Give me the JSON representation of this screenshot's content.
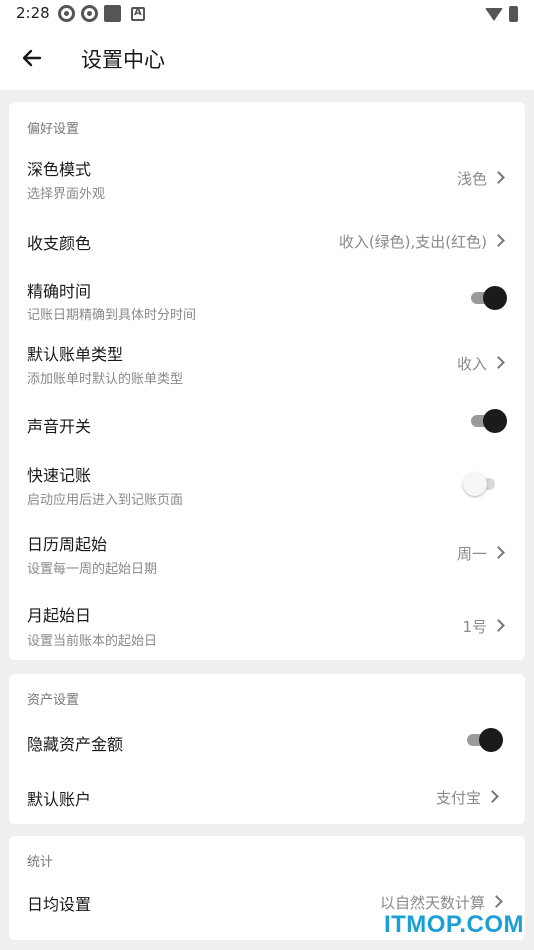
{
  "status_bar": {
    "time": "2:28",
    "icons": [
      "aperture-icon",
      "aperture-icon",
      "square-icon",
      "a-box-icon"
    ],
    "right_icons": [
      "wifi-icon",
      "battery-icon"
    ]
  },
  "app_bar": {
    "title": "设置中心",
    "back_icon": "arrow-left-icon"
  },
  "sections": {
    "preferences": {
      "title": "偏好设置",
      "dark_mode": {
        "label": "深色模式",
        "subtitle": "选择界面外观",
        "value": "浅色"
      },
      "color": {
        "label": "收支颜色",
        "value": "收入(绿色),支出(红色)"
      },
      "precise_time": {
        "label": "精确时间",
        "subtitle": "记账日期精确到具体时分时间",
        "on": true
      },
      "default_type": {
        "label": "默认账单类型",
        "subtitle": "添加账单时默认的账单类型",
        "value": "收入"
      },
      "sound": {
        "label": "声音开关",
        "on": true
      },
      "quick": {
        "label": "快速记账",
        "subtitle": "启动应用后进入到记账页面",
        "on": false
      },
      "week_start": {
        "label": "日历周起始",
        "subtitle": "设置每一周的起始日期",
        "value": "周一"
      },
      "month_start": {
        "label": "月起始日",
        "subtitle": "设置当前账本的起始日",
        "value": "1号"
      }
    },
    "assets": {
      "title": "资产设置",
      "hide_amount": {
        "label": "隐藏资产金额",
        "on": true
      },
      "default_account": {
        "label": "默认账户",
        "value": "支付宝"
      }
    },
    "stats": {
      "title": "统计",
      "daily_avg": {
        "label": "日均设置",
        "value": "以自然天数计算"
      }
    }
  },
  "watermark": "ITMOP.COM",
  "colors": {
    "switch_knob_on": "#1b1b1b",
    "switch_track_on": "#9a9a9a",
    "watermark": "#1aa0d6"
  }
}
